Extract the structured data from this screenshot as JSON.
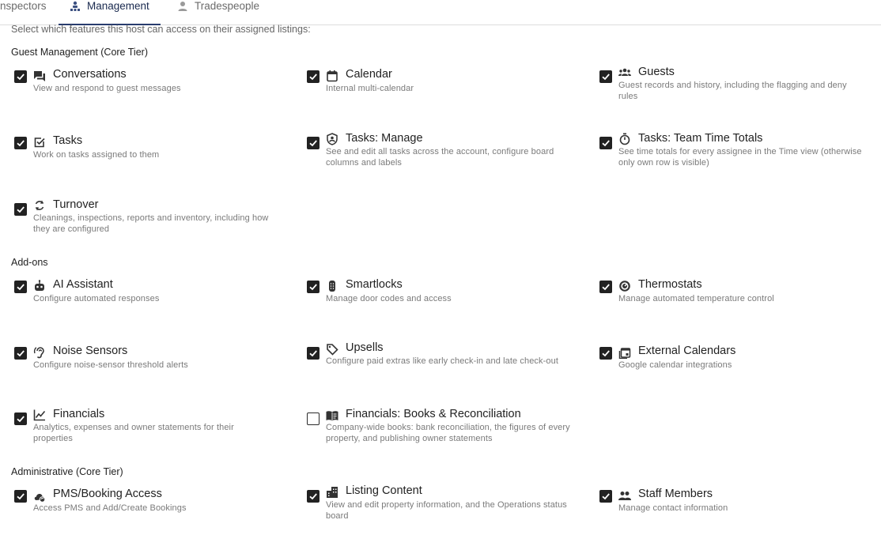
{
  "tabs": [
    {
      "label": "nspectors",
      "icon": "person-icon",
      "active": false
    },
    {
      "label": "Management",
      "icon": "management-icon",
      "active": true
    },
    {
      "label": "Tradespeople",
      "icon": "person-icon",
      "active": false
    }
  ],
  "intro": "Select which features this host can access on their assigned listings:",
  "sections": [
    {
      "title": "Guest Management (Core Tier)",
      "items": [
        {
          "title": "Conversations",
          "desc": "View and respond to guest messages",
          "checked": true,
          "icon": "chat-icon"
        },
        {
          "title": "Calendar",
          "desc": "Internal multi-calendar",
          "checked": true,
          "icon": "calendar-icon"
        },
        {
          "title": "Guests",
          "desc": "Guest records and history, including the flagging and deny rules",
          "checked": true,
          "icon": "guests-icon"
        },
        {
          "title": "Tasks",
          "desc": "Work on tasks assigned to them",
          "checked": true,
          "icon": "task-check-icon"
        },
        {
          "title": "Tasks: Manage",
          "desc": "See and edit all tasks across the account, configure board columns and labels",
          "checked": true,
          "icon": "admin-shield-icon"
        },
        {
          "title": "Tasks: Team Time Totals",
          "desc": "See time totals for every assignee in the Time view (otherwise only own row is visible)",
          "checked": true,
          "icon": "stopwatch-icon"
        },
        {
          "title": "Turnover",
          "desc": "Cleanings, inspections, reports and inventory, including how they are configured",
          "checked": true,
          "icon": "sync-icon"
        }
      ]
    },
    {
      "title": "Add-ons",
      "items": [
        {
          "title": "AI Assistant",
          "desc": "Configure automated responses",
          "checked": true,
          "icon": "robot-icon"
        },
        {
          "title": "Smartlocks",
          "desc": "Manage door codes and access",
          "checked": true,
          "icon": "keypad-icon"
        },
        {
          "title": "Thermostats",
          "desc": "Manage automated temperature control",
          "checked": true,
          "icon": "thermostat-icon"
        },
        {
          "title": "Noise Sensors",
          "desc": "Configure noise-sensor threshold alerts",
          "checked": true,
          "icon": "hearing-icon"
        },
        {
          "title": "Upsells",
          "desc": "Configure paid extras like early check-in and late check-out",
          "checked": true,
          "icon": "tag-icon"
        },
        {
          "title": "External Calendars",
          "desc": "Google calendar integrations",
          "checked": true,
          "icon": "external-calendar-icon"
        },
        {
          "title": "Financials",
          "desc": "Analytics, expenses and owner statements for their properties",
          "checked": true,
          "icon": "line-chart-icon"
        },
        {
          "title": "Financials: Books & Reconciliation",
          "desc": "Company-wide books: bank reconciliation, the figures of every property, and publishing owner statements",
          "checked": false,
          "icon": "book-icon"
        }
      ]
    },
    {
      "title": "Administrative (Core Tier)",
      "items": [
        {
          "title": "PMS/Booking Access",
          "desc": "Access PMS and Add/Create Bookings",
          "checked": true,
          "icon": "cloud-sync-icon"
        },
        {
          "title": "Listing Content",
          "desc": "View and edit property information, and the Operations status board",
          "checked": true,
          "icon": "building-icon"
        },
        {
          "title": "Staff Members",
          "desc": "Manage contact information",
          "checked": true,
          "icon": "people-icon"
        }
      ]
    }
  ]
}
